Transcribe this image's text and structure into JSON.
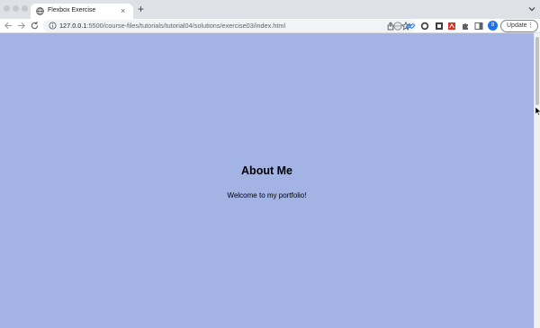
{
  "browser": {
    "tab": {
      "title": "Flexbox Exercise",
      "close_label": "×",
      "favicon": "globe-icon"
    },
    "new_tab_label": "+",
    "address_bar": {
      "host": "127.0.0.1",
      "rest": ":5500/course-files/tutorials/tutorial04/solutions/exercise03/index.html"
    },
    "avatar_label": "8",
    "update_button": {
      "label": "Update",
      "menu": "⋮"
    },
    "icons": [
      "back-arrow-icon",
      "forward-arrow-icon",
      "reload-icon",
      "info-icon",
      "share-icon",
      "star-icon",
      "extension-icon",
      "puzzle-icon",
      "side-panel-icon"
    ]
  },
  "page": {
    "heading": "About Me",
    "text": "Welcome to my portfolio!",
    "background_color": "#a2b3e4"
  }
}
